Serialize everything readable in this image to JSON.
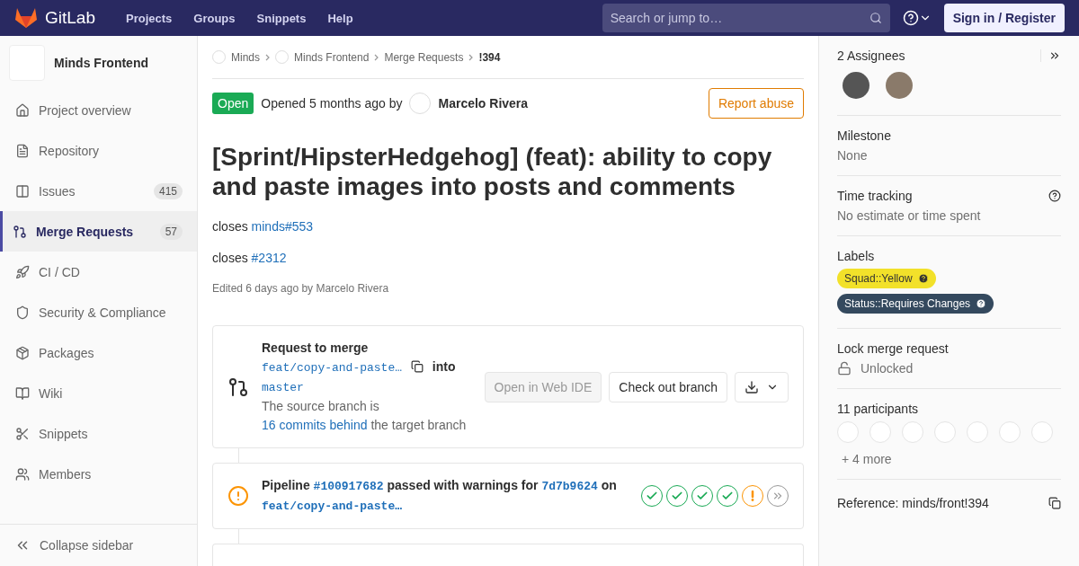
{
  "topbar": {
    "logo": "GitLab",
    "nav": [
      "Projects",
      "Groups",
      "Snippets",
      "Help"
    ],
    "search": {
      "placeholder": "Search or jump to…"
    },
    "sign_in": "Sign in / Register"
  },
  "sidebar": {
    "project": "Minds Frontend",
    "items": [
      {
        "label": "Project overview",
        "selected": false
      },
      {
        "label": "Repository",
        "selected": false
      },
      {
        "label": "Issues",
        "count": "415",
        "selected": false
      },
      {
        "label": "Merge Requests",
        "count": "57",
        "selected": true
      },
      {
        "label": "CI / CD",
        "selected": false
      },
      {
        "label": "Security & Compliance",
        "selected": false
      },
      {
        "label": "Packages",
        "selected": false
      },
      {
        "label": "Wiki",
        "selected": false
      },
      {
        "label": "Snippets",
        "selected": false
      },
      {
        "label": "Members",
        "selected": false
      }
    ],
    "collapse": "Collapse sidebar"
  },
  "breadcrumbs": [
    {
      "label": "Minds",
      "kind": "avatar"
    },
    {
      "label": "Minds Frontend",
      "kind": "avatar"
    },
    {
      "label": "Merge Requests",
      "kind": "plain"
    },
    {
      "label": "!394",
      "kind": "current"
    }
  ],
  "header": {
    "status": "Open",
    "opened": "Opened 5 months ago by",
    "author": "Marcelo Rivera",
    "report": "Report abuse"
  },
  "title": "[Sprint/HipsterHedgehog] (feat): ability to copy and paste images into posts and comments",
  "description": [
    {
      "text": "closes",
      "link": "minds#553"
    },
    {
      "text": "closes",
      "link": "#2312"
    }
  ],
  "edited": "Edited 6 days ago by Marcelo Rivera",
  "merge_widget": {
    "heading": "Request to merge",
    "source": "feat/copy-and-paste…",
    "into": "into",
    "target": "master",
    "behind_prefix": "The source branch is",
    "behind_link": "16 commits behind",
    "behind_suffix": "the target branch",
    "web_ide": {
      "label": "Open in Web IDE",
      "disabled": true
    },
    "checkout": "Check out branch"
  },
  "pipeline": {
    "label": "Pipeline",
    "id": "#100917682",
    "status_text": "passed with warnings for",
    "commit": "7d7b9624",
    "on": "on",
    "branch": "feat/copy-and-paste…",
    "stages": [
      {
        "kind": "success"
      },
      {
        "kind": "success"
      },
      {
        "kind": "success"
      },
      {
        "kind": "success"
      },
      {
        "kind": "warning"
      }
    ]
  },
  "right_sidebar": {
    "assignees": {
      "title": "2 Assignees",
      "avatars": [
        {
          "kind": "photo"
        },
        {
          "kind": "photo"
        }
      ]
    },
    "milestone": {
      "title": "Milestone",
      "value": "None"
    },
    "time_tracking": {
      "title": "Time tracking",
      "value": "No estimate or time spent"
    },
    "labels": {
      "title": "Labels",
      "items": [
        {
          "text": "Squad::Yellow",
          "color": "#f2e12a"
        },
        {
          "text": "Status::Requires Changes",
          "color": "#34495e"
        }
      ]
    },
    "lock": {
      "title": "Lock merge request",
      "value": "Unlocked",
      "locked": false
    },
    "participants": {
      "title": "11 participants",
      "avatars": [
        {
          "kind": "empty"
        },
        {
          "kind": "empty"
        },
        {
          "kind": "empty"
        },
        {
          "kind": "empty"
        },
        {
          "kind": "empty"
        },
        {
          "kind": "empty"
        },
        {
          "kind": "empty"
        }
      ],
      "more": "+ 4 more"
    },
    "reference": "Reference: minds/front!394"
  }
}
